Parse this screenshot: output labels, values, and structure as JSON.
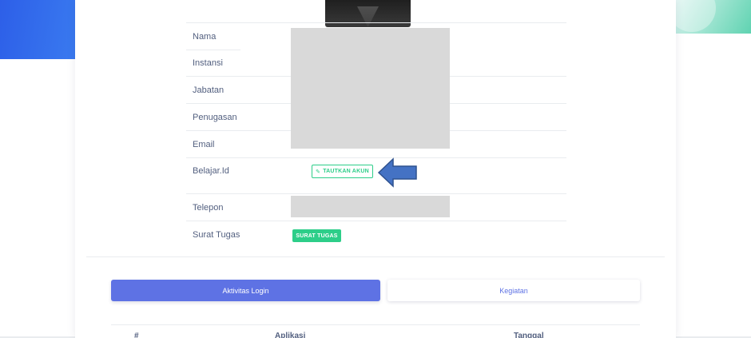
{
  "profile": {
    "rows": [
      {
        "label": "Nama"
      },
      {
        "label": "Instansi"
      },
      {
        "label": "Jabatan"
      },
      {
        "label": "Penugasan"
      },
      {
        "label": "Email"
      },
      {
        "label": "Belajar.Id"
      },
      {
        "label": "Telepon"
      },
      {
        "label": "Surat Tugas"
      }
    ],
    "link_account_label": "TAUTKAN AKUN",
    "surat_tugas_label": "SURAT TUGAS"
  },
  "tabs": [
    {
      "label": "Aktivitas Login",
      "active": true
    },
    {
      "label": "Kegiatan",
      "active": false
    }
  ],
  "table": {
    "headers": [
      "#",
      "Aplikasi",
      "Tanggal"
    ]
  },
  "colors": {
    "primary": "#5e72e4",
    "success": "#2dce89",
    "annotation_arrow": "#4472c4"
  }
}
